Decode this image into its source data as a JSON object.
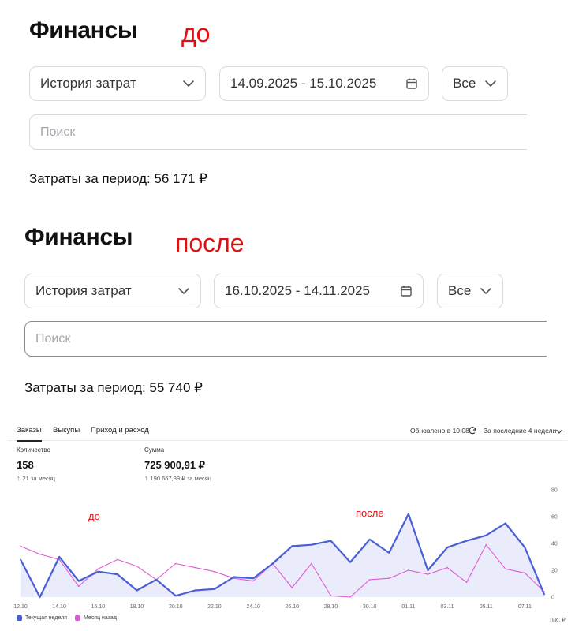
{
  "before": {
    "title": "Финансы",
    "tag": "до",
    "type_select": "История затрат",
    "date_range": "14.09.2025 - 15.10.2025",
    "filter_select": "Все",
    "search_placeholder": "Поиск",
    "total": "Затраты за период: 56 171 ₽"
  },
  "after": {
    "title": "Финансы",
    "tag": "после",
    "type_select": "История затрат",
    "date_range": "16.10.2025 - 14.11.2025",
    "filter_select": "Все",
    "search_placeholder": "Поиск",
    "total": "Затраты за период: 55 740 ₽"
  },
  "widget": {
    "tabs": [
      {
        "label": "Заказы",
        "selected": true
      },
      {
        "label": "Выкупы",
        "selected": false
      },
      {
        "label": "Приход и расход",
        "selected": false
      }
    ],
    "updated": "Обновлено в 10:08",
    "period": "За последние 4 недели",
    "metrics": {
      "count": {
        "label": "Количество",
        "value": "158",
        "delta": "21 за месяц"
      },
      "sum": {
        "label": "Сумма",
        "value": "725 900,91 ₽",
        "delta": "190 667,39 ₽ за месяц"
      }
    },
    "annotations": {
      "before": "до",
      "after": "после"
    },
    "unit": "Тыс. ₽"
  },
  "chart_data": {
    "type": "line",
    "x": [
      "12.10",
      "13.10",
      "14.10",
      "15.10",
      "16.10",
      "17.10",
      "18.10",
      "19.10",
      "20.10",
      "21.10",
      "22.10",
      "23.10",
      "24.10",
      "25.10",
      "26.10",
      "27.10",
      "28.10",
      "29.10",
      "30.10",
      "31.10",
      "01.11",
      "02.11",
      "03.11",
      "04.11",
      "05.11",
      "06.11",
      "07.11",
      "08.11"
    ],
    "tick_labels": [
      "12.10",
      "14.10",
      "16.10",
      "18.10",
      "20.10",
      "22.10",
      "24.10",
      "26.10",
      "28.10",
      "30.10",
      "01.11",
      "03.11",
      "05.11",
      "07.11"
    ],
    "ylim": [
      0,
      80
    ],
    "yticks": [
      0,
      20,
      40,
      60,
      80
    ],
    "series": [
      {
        "name": "Текущая неделя",
        "color": "#4a5fd6",
        "values": [
          28,
          0,
          30,
          12,
          19,
          17,
          5,
          13,
          1,
          5,
          6,
          15,
          14,
          25,
          38,
          39,
          42,
          26,
          43,
          33,
          62,
          20,
          37,
          42,
          46,
          55,
          37,
          2
        ]
      },
      {
        "name": "Месяц назад",
        "color": "#e05ad6",
        "values": [
          38,
          32,
          28,
          8,
          21,
          28,
          23,
          13,
          25,
          22,
          19,
          14,
          12,
          25,
          7,
          25,
          1,
          0,
          13,
          14,
          20,
          17,
          22,
          11,
          39,
          21,
          18,
          4
        ]
      }
    ],
    "grid": false,
    "legend": "bottom-left"
  }
}
